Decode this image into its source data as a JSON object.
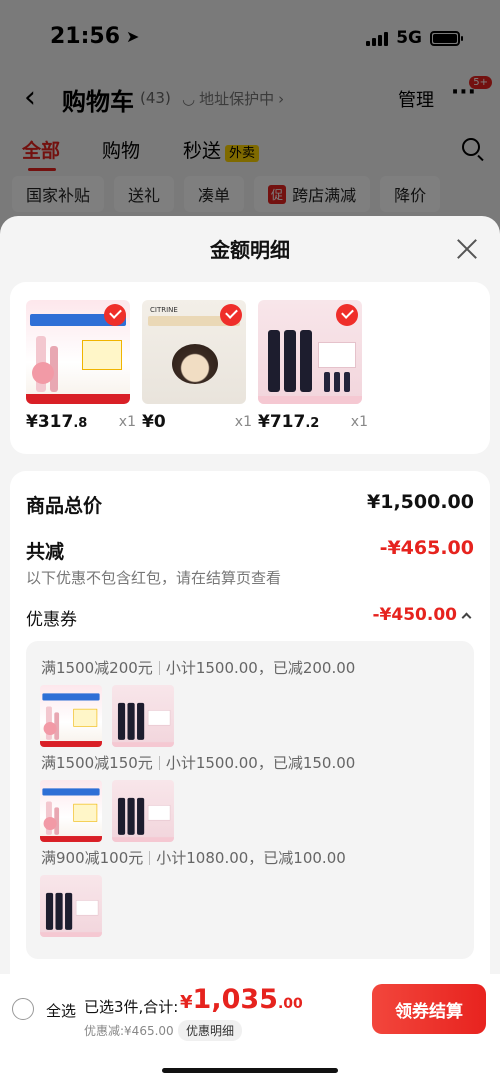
{
  "status_bar": {
    "time": "21:56",
    "network": "5G"
  },
  "header": {
    "title": "购物车",
    "count": "(43)",
    "address_protect": "地址保护中",
    "manage": "管理",
    "more_badge": "5+"
  },
  "tabs": [
    {
      "label": "全部",
      "active": true
    },
    {
      "label": "购物"
    },
    {
      "label": "秒送",
      "tag": "外卖"
    }
  ],
  "chips": [
    {
      "label": "国家补贴"
    },
    {
      "label": "送礼"
    },
    {
      "label": "凑单"
    },
    {
      "label": "跨店满减",
      "badge": "促"
    },
    {
      "label": "降价"
    }
  ],
  "sheet": {
    "title": "金额明细",
    "products": [
      {
        "price_main": "¥317",
        "price_dec": ".8",
        "qty": "x1"
      },
      {
        "price_main": "¥0",
        "price_dec": "",
        "qty": "x1"
      },
      {
        "price_main": "¥717",
        "price_dec": ".2",
        "qty": "x1"
      }
    ],
    "summary": {
      "total_label": "商品总价",
      "total_value": "¥1,500.00",
      "discount_label": "共减",
      "discount_value": "-¥465.00",
      "note": "以下优惠不包含红包，请在结算页查看",
      "coupon_label": "优惠券",
      "coupon_value": "-¥450.00"
    },
    "coupon_rules": [
      {
        "rule": "满1500减200元",
        "detail": "小计1500.00，已减200.00"
      },
      {
        "rule": "满1500减150元",
        "detail": "小计1500.00，已减150.00"
      },
      {
        "rule": "满900减100元",
        "detail": "小计1080.00，已减100.00"
      }
    ]
  },
  "bottom_bar": {
    "select_all": "全选",
    "selected_info": "已选3件,合计:",
    "total_symbol": "¥",
    "total_main": "1,035",
    "total_dec": ".00",
    "discount_info": "优惠减:¥465.00",
    "detail_link": "优惠明细",
    "checkout": "领券结算"
  },
  "colors": {
    "accent": "#e6231e",
    "overlay": "rgba(0,0,0,0.5)"
  }
}
